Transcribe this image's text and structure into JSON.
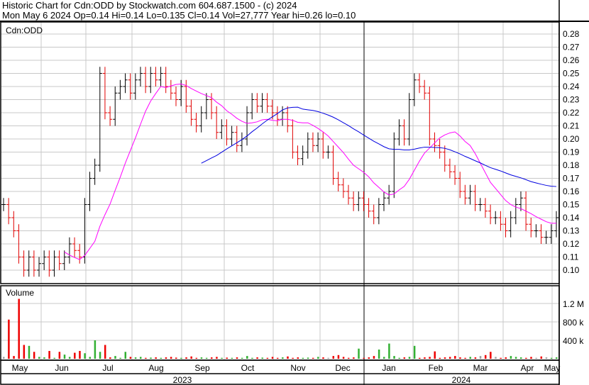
{
  "header": {
    "line1": "Historic Chart for Cdn:ODD by Stockwatch.com 604.687.1500 - (c) 2024",
    "line2": "Mon May  6 2024  Op=0.14  Hi=0.14  Lo=0.135  Cl=0.14  Vol=27,777  Year hi=0.26  lo=0.10"
  },
  "chart_data": {
    "type": "line",
    "title": "Cdn:ODD",
    "volume_label": "Volume",
    "price_ticks": [
      0.28,
      0.27,
      0.26,
      0.25,
      0.24,
      0.23,
      0.22,
      0.21,
      0.2,
      0.19,
      0.18,
      0.17,
      0.16,
      0.15,
      0.14,
      0.13,
      0.12,
      0.11,
      0.1
    ],
    "ylim": [
      0.095,
      0.29
    ],
    "volume_ticks": [
      {
        "v": 1200,
        "label": "1.2 M"
      },
      {
        "v": 800,
        "label": "800 k"
      },
      {
        "v": 400,
        "label": "400 k"
      }
    ],
    "months": [
      "May",
      "Jun",
      "Jul",
      "Aug",
      "Sep",
      "Oct",
      "Nov",
      "Dec",
      "Jan",
      "Feb",
      "Mar",
      "Apr",
      "May"
    ],
    "years": [
      "2023",
      "2024"
    ],
    "close": [
      0.15,
      0.14,
      0.13,
      0.11,
      0.1,
      0.11,
      0.1,
      0.105,
      0.11,
      0.1,
      0.11,
      0.105,
      0.11,
      0.12,
      0.115,
      0.11,
      0.15,
      0.17,
      0.18,
      0.25,
      0.22,
      0.215,
      0.235,
      0.24,
      0.245,
      0.235,
      0.245,
      0.25,
      0.24,
      0.25,
      0.245,
      0.25,
      0.24,
      0.235,
      0.23,
      0.24,
      0.225,
      0.215,
      0.21,
      0.22,
      0.23,
      0.22,
      0.205,
      0.21,
      0.2,
      0.205,
      0.195,
      0.2,
      0.22,
      0.23,
      0.225,
      0.23,
      0.225,
      0.22,
      0.215,
      0.22,
      0.21,
      0.19,
      0.185,
      0.19,
      0.2,
      0.195,
      0.2,
      0.19,
      0.19,
      0.17,
      0.165,
      0.16,
      0.155,
      0.15,
      0.155,
      0.15,
      0.145,
      0.14,
      0.15,
      0.155,
      0.16,
      0.2,
      0.21,
      0.2,
      0.23,
      0.245,
      0.24,
      0.235,
      0.2,
      0.195,
      0.19,
      0.18,
      0.175,
      0.17,
      0.16,
      0.155,
      0.16,
      0.15,
      0.15,
      0.145,
      0.14,
      0.14,
      0.135,
      0.13,
      0.14,
      0.15,
      0.155,
      0.135,
      0.13,
      0.13,
      0.125,
      0.125,
      0.13,
      0.14
    ],
    "volume_k": [
      40,
      850,
      60,
      1300,
      300,
      280,
      150,
      40,
      30,
      170,
      20,
      150,
      90,
      40,
      130,
      170,
      120,
      40,
      400,
      150,
      300,
      30,
      60,
      20,
      150,
      40,
      30,
      40,
      20,
      25,
      30,
      20,
      30,
      40,
      25,
      20,
      30,
      50,
      20,
      30,
      20,
      30,
      40,
      20,
      25,
      20,
      30,
      20,
      60,
      20,
      30,
      25,
      20,
      40,
      20,
      30,
      50,
      20,
      30,
      20,
      25,
      20,
      40,
      30,
      20,
      60,
      80,
      40,
      20,
      30,
      220,
      20,
      30,
      60,
      200,
      40,
      330,
      60,
      20,
      30,
      40,
      280,
      20,
      30,
      40,
      160,
      20,
      30,
      40,
      60,
      30,
      20,
      40,
      30,
      60,
      80,
      150,
      40,
      20,
      30,
      60,
      40,
      30,
      20,
      40,
      20,
      50,
      30,
      20,
      30
    ],
    "ma_periods": [
      13,
      40
    ],
    "colors": {
      "up": "#000000",
      "down": "#e00000",
      "ma_short": "#ff00ff",
      "ma_long": "#0000e0",
      "vol_up": "#33b033",
      "vol_down": "#ee0000",
      "vol_flat": "#a0a0a0",
      "grid": "#c8c8c8"
    }
  }
}
